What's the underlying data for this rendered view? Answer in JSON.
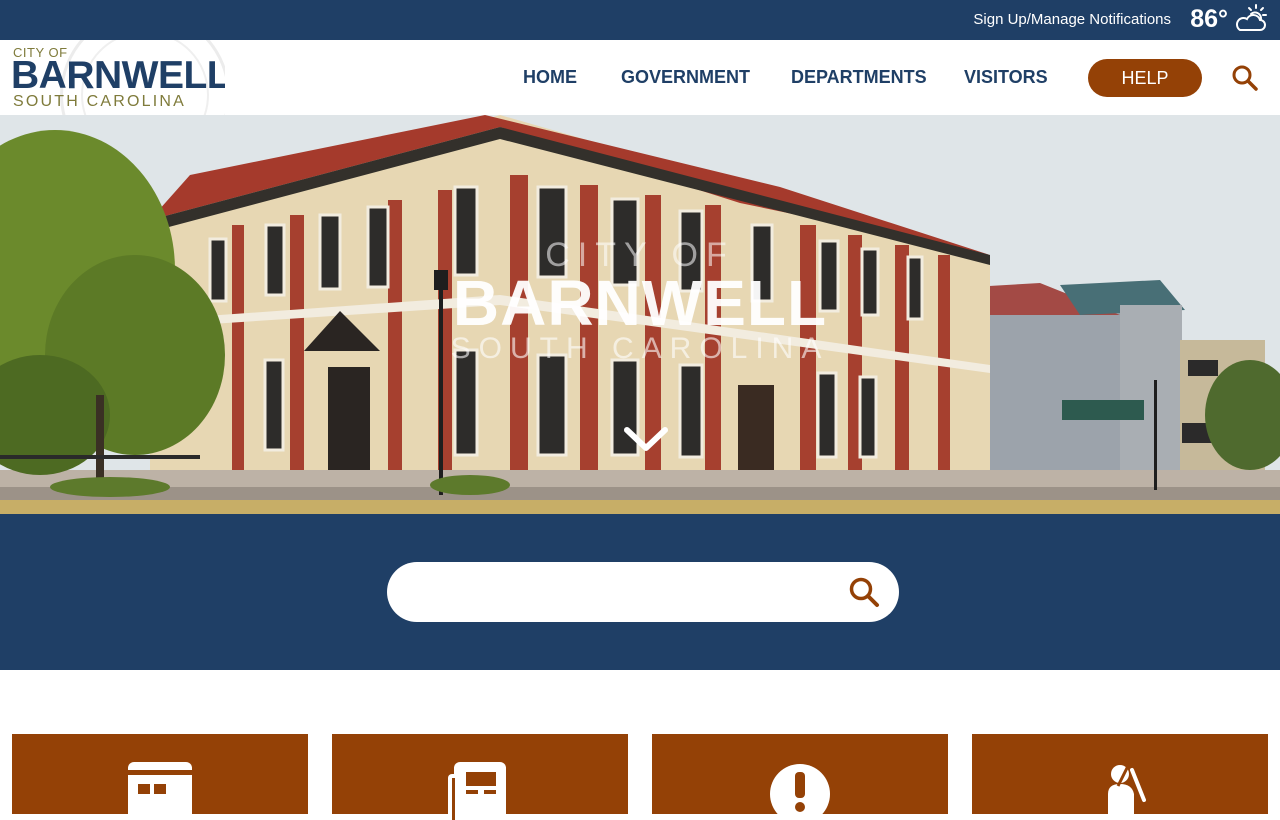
{
  "topbar": {
    "notify_label": "Sign Up/Manage Notifications",
    "temperature": "86°",
    "weather_icon": "partly-cloudy-icon"
  },
  "logo": {
    "city_of": "CITY OF",
    "name": "BARNWELL",
    "state": "SOUTH CAROLINA"
  },
  "nav": {
    "items": [
      {
        "label": "HOME"
      },
      {
        "label": "GOVERNMENT"
      },
      {
        "label": "DEPARTMENTS"
      },
      {
        "label": "VISITORS"
      }
    ],
    "help_label": "HELP",
    "search_icon": "search-icon"
  },
  "hero": {
    "city_of": "CITY OF",
    "name": "BARNWELL",
    "state": "SOUTH CAROLINA",
    "scroll_icon": "chevron-down-icon"
  },
  "search": {
    "value": "",
    "placeholder": "",
    "icon": "search-icon"
  },
  "quick_links": [
    {
      "icon": "calendar-icon"
    },
    {
      "icon": "newspaper-icon"
    },
    {
      "icon": "alert-icon"
    },
    {
      "icon": "worker-shovel-icon"
    }
  ],
  "colors": {
    "navy": "#1f3f66",
    "rust": "#944106",
    "gold": "#c7ae67",
    "olive": "#7f7b3b"
  }
}
